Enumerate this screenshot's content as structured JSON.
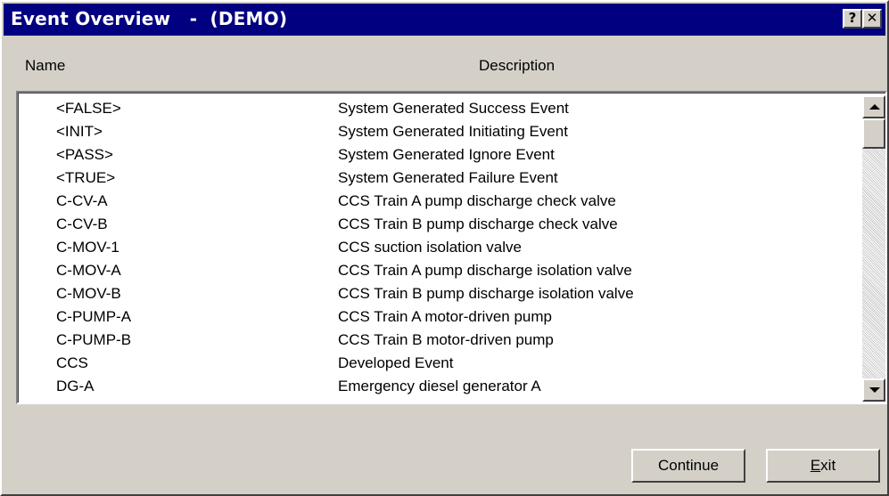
{
  "window": {
    "title": "Event Overview   -  (DEMO)",
    "help_label": "?",
    "close_label": "✕"
  },
  "columns": {
    "name": "Name",
    "description": "Description"
  },
  "rows": [
    {
      "name": "<FALSE>",
      "description": "System Generated Success Event"
    },
    {
      "name": "<INIT>",
      "description": "System Generated Initiating Event"
    },
    {
      "name": "<PASS>",
      "description": "System Generated Ignore Event"
    },
    {
      "name": "<TRUE>",
      "description": "System Generated Failure Event"
    },
    {
      "name": "C-CV-A",
      "description": "CCS Train A pump discharge check valve"
    },
    {
      "name": "C-CV-B",
      "description": "CCS Train B pump discharge check valve"
    },
    {
      "name": "C-MOV-1",
      "description": "CCS suction isolation valve"
    },
    {
      "name": "C-MOV-A",
      "description": "CCS Train A pump discharge isolation valve"
    },
    {
      "name": "C-MOV-B",
      "description": "CCS Train B pump discharge isolation valve"
    },
    {
      "name": "C-PUMP-A",
      "description": "CCS Train A motor-driven pump"
    },
    {
      "name": "C-PUMP-B",
      "description": "CCS Train B motor-driven pump"
    },
    {
      "name": "CCS",
      "description": "Developed Event"
    },
    {
      "name": "DG-A",
      "description": "Emergency diesel generator A"
    }
  ],
  "buttons": {
    "continue_label": "Continue",
    "exit_mnemonic": "E",
    "exit_rest": "xit"
  },
  "colors": {
    "titlebar": "#000080",
    "face": "#d4d0c8"
  }
}
